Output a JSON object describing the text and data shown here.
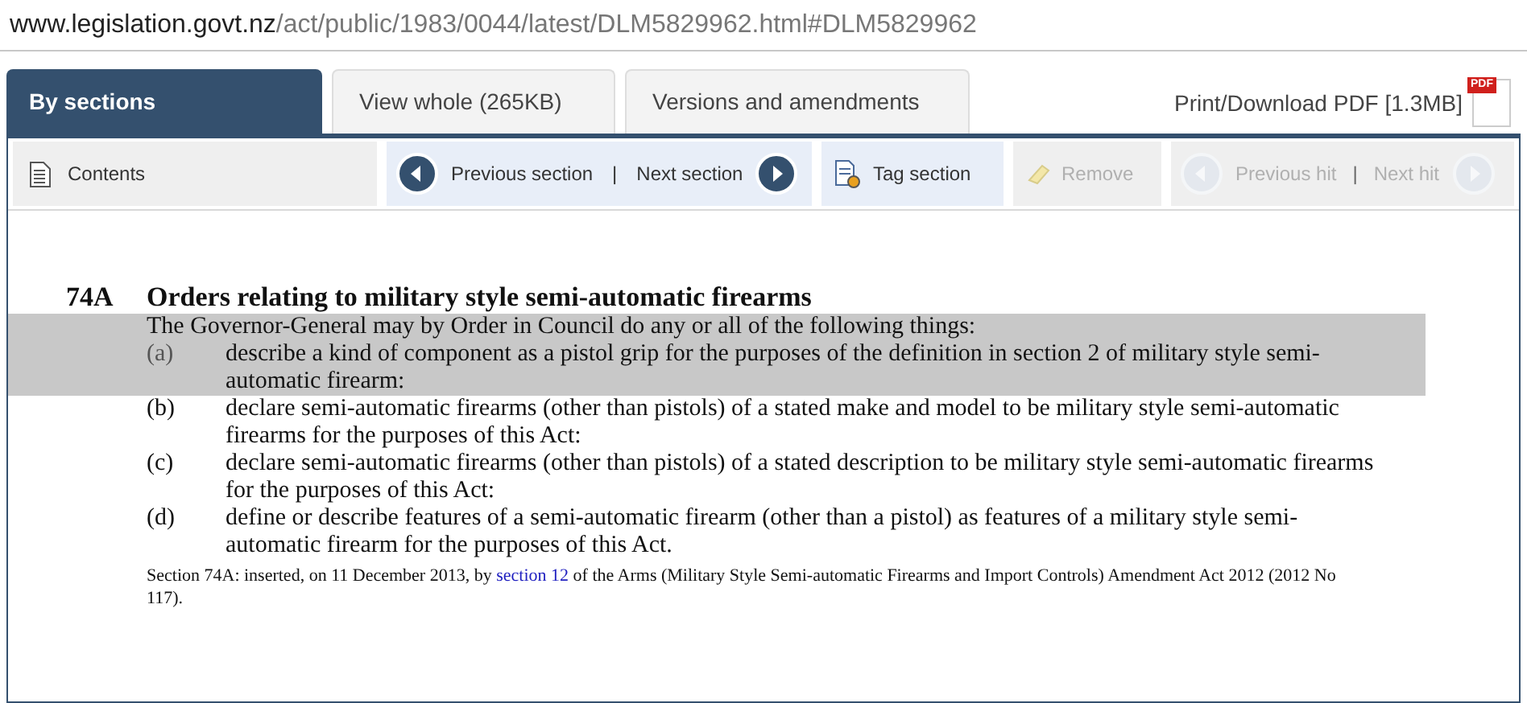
{
  "address_bar": {
    "host": "www.legislation.govt.nz",
    "path": "/act/public/1983/0044/latest/DLM5829962.html#DLM5829962"
  },
  "tabs": [
    {
      "label": "By sections",
      "selected": true
    },
    {
      "label": "View whole (265KB)",
      "selected": false
    },
    {
      "label": "Versions and amendments",
      "selected": false
    }
  ],
  "print_link": "Print/Download PDF [1.3MB]",
  "pdf_icon_label": "PDF",
  "toolbar": {
    "contents": "Contents",
    "previous_section": "Previous section",
    "separator_1": "|",
    "next_section": "Next section",
    "tag_section": "Tag section",
    "remove": {
      "label": "Remove",
      "disabled": true
    },
    "previous_hit": {
      "label": "Previous hit",
      "disabled": true
    },
    "separator_2": "|",
    "next_hit": {
      "label": "Next hit",
      "disabled": true
    }
  },
  "section": {
    "number": "74A",
    "title": "Orders relating to military style semi-automatic firearms",
    "intro": {
      "text": "The Governor-General may by Order in Council do any or all of the following things:",
      "highlighted": true
    },
    "items": [
      {
        "label": "(a)",
        "text": "describe a kind of component as a pistol grip for the purposes of the definition in section 2 of military style semi-automatic firearm:",
        "highlighted": true
      },
      {
        "label": "(b)",
        "text": "declare semi-automatic firearms (other than pistols) of a stated make and model to be military style semi-automatic firearms for the purposes of this Act:",
        "highlighted": false
      },
      {
        "label": "(c)",
        "text": "declare semi-automatic firearms (other than pistols) of a stated description to be military style semi-automatic firearms for the purposes of this Act:",
        "highlighted": false
      },
      {
        "label": "(d)",
        "text": "define or describe features of a semi-automatic firearm (other than a pistol) as features of a military style semi-automatic firearm for the purposes of this Act.",
        "highlighted": false
      }
    ],
    "history_note": {
      "before": "Section 74A: inserted, on 11 December 2013, by",
      "link": "section 12",
      "after": "of the Arms (Military Style Semi-automatic Firearms and Import Controls) Amendment Act 2012 (2012 No 117)."
    }
  }
}
